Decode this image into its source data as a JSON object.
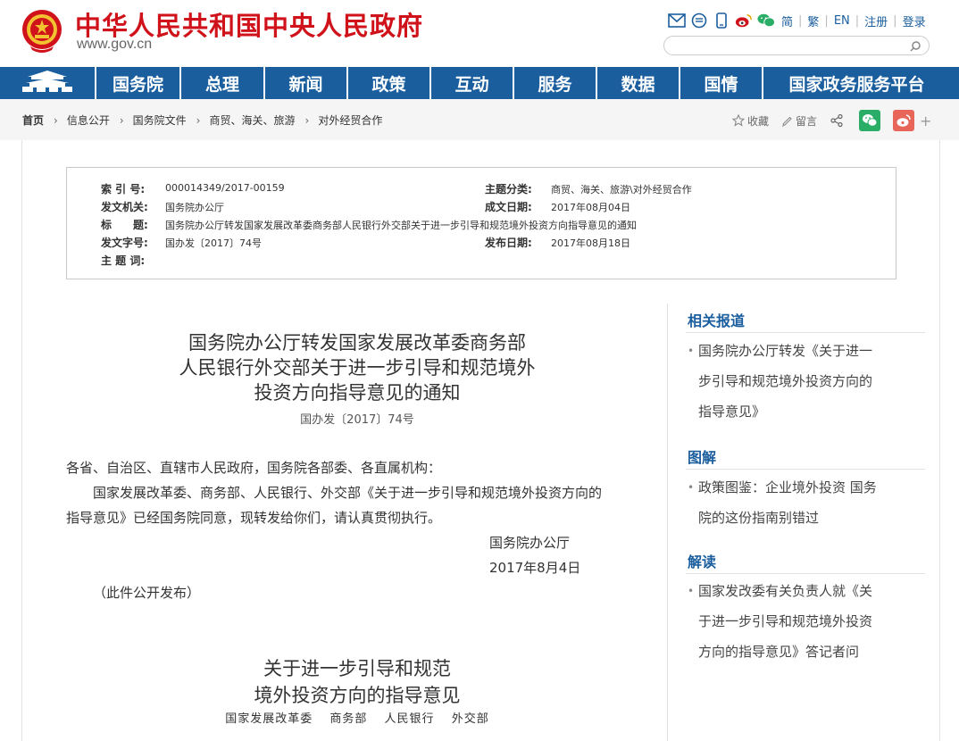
{
  "header": {
    "site_name": "中华人民共和国中央人民政府",
    "site_url": "www.gov.cn",
    "lang_links": [
      "简",
      "繁",
      "EN",
      "注册",
      "登录"
    ],
    "search": {
      "placeholder": "",
      "value": ""
    }
  },
  "nav": {
    "items": [
      "国务院",
      "总理",
      "新闻",
      "政策",
      "互动",
      "服务",
      "数据",
      "国情",
      "国家政务服务平台"
    ]
  },
  "breadcrumb": {
    "items": [
      "首页",
      "信息公开",
      "国务院文件",
      "商贸、海关、旅游",
      "对外经贸合作"
    ]
  },
  "tools": {
    "favorite": "收藏",
    "message": "留言"
  },
  "info_table": {
    "index_label": "索 引 号:",
    "index_value": "000014349/2017-00159",
    "topic_label": "主题分类:",
    "topic_value": "商贸、海关、旅游\\对外经贸合作",
    "issuer_label": "发文机关:",
    "issuer_value": "国务院办公厅",
    "date_written_label": "成文日期:",
    "date_written_value": "2017年08月04日",
    "title_label": "标　　题:",
    "title_value": "国务院办公厅转发国家发展改革委商务部人民银行外交部关于进一步引导和规范境外投资方向指导意见的通知",
    "docno_label": "发文字号:",
    "docno_value": "国办发〔2017〕74号",
    "pubdate_label": "发布日期:",
    "pubdate_value": "2017年08月18日",
    "subject_label": "主 题 词:",
    "subject_value": ""
  },
  "article": {
    "title_lines": [
      "国务院办公厅转发国家发展改革委商务部",
      "人民银行外交部关于进一步引导和规范境外",
      "投资方向指导意见的通知"
    ],
    "doc_number": "国办发〔2017〕74号",
    "salutation": "各省、自治区、直辖市人民政府，国务院各部委、各直属机构：",
    "para_line1": "国家发展改革委、商务部、人民银行、外交部《关于进一步引导和规范境外投资方向的",
    "para_line2": "指导意见》已经国务院同意，现转发给你们，请认真贯彻执行。",
    "signature": "国务院办公厅",
    "sign_date": "2017年8月4日",
    "publish_note": "（此件公开发布）",
    "attachment_title_lines": [
      "关于进一步引导和规范",
      "境外投资方向的指导意见"
    ],
    "attachment_orgs": "国家发展改革委 商务部 人民银行 外交部"
  },
  "sidebar": {
    "sections": [
      {
        "heading": "相关报道",
        "items": [
          {
            "lines": [
              "国务院办公厅转发《关于进一",
              "步引导和规范境外投资方向的",
              "指导意见》"
            ]
          }
        ]
      },
      {
        "heading": "图解",
        "items": [
          {
            "lines": [
              "政策图鉴：企业境外投资 国务",
              "院的这份指南别错过"
            ]
          }
        ]
      },
      {
        "heading": "解读",
        "items": [
          {
            "lines": [
              "国家发改委有关负责人就《关",
              "于进一步引导和规范境外投资",
              "方向的指导意见》答记者问"
            ]
          }
        ]
      }
    ]
  },
  "colors": {
    "brand_red": "#d0121b",
    "nav_blue": "#1b5e9e",
    "wechat_green": "#2aae67",
    "weibo_red": "#e8655a"
  }
}
